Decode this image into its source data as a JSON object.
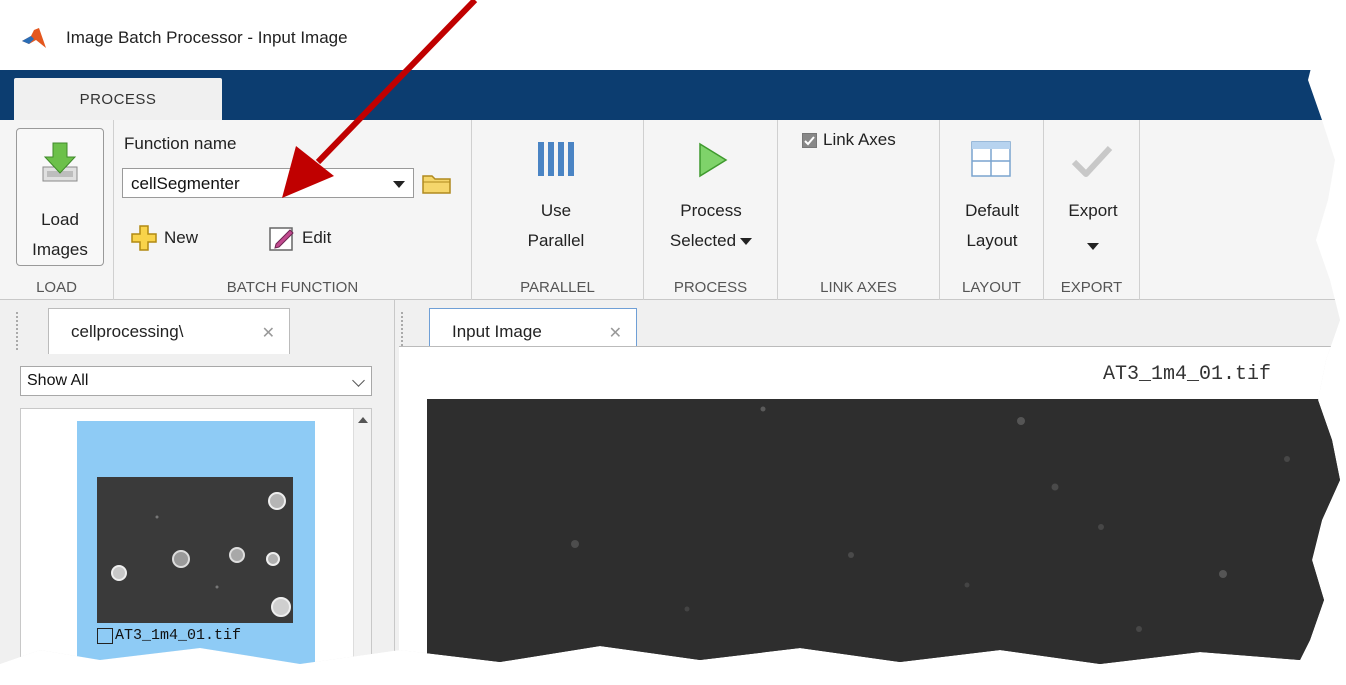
{
  "window": {
    "title": "Image Batch Processor - Input Image"
  },
  "toolstrip": {
    "active_tab": "PROCESS"
  },
  "ribbon": {
    "load": {
      "button_line1": "Load",
      "button_line2": "Images",
      "group_label": "LOAD"
    },
    "batch_function": {
      "function_name_label": "Function name",
      "function_name_value": "cellSegmenter",
      "new_label": "New",
      "edit_label": "Edit",
      "group_label": "BATCH FUNCTION"
    },
    "parallel": {
      "button_line1": "Use",
      "button_line2": "Parallel",
      "group_label": "PARALLEL"
    },
    "process": {
      "button_line1": "Process",
      "button_line2": "Selected",
      "group_label": "PROCESS"
    },
    "link_axes": {
      "checkbox_label": "Link Axes",
      "checked": true,
      "group_label": "LINK AXES"
    },
    "layout": {
      "button_line1": "Default",
      "button_line2": "Layout",
      "group_label": "LAYOUT"
    },
    "export": {
      "button_line1": "Export",
      "group_label": "EXPORT"
    }
  },
  "left_panel": {
    "tab_label": "cellprocessing\\",
    "filter_value": "Show All",
    "thumbnails": [
      {
        "label": "AT3_1m4_01.tif",
        "selected": true
      }
    ]
  },
  "right_panel": {
    "tab_label": "Input Image",
    "image_filename": "AT3_1m4_01.tif"
  },
  "colors": {
    "toolstrip_blue": "#0c3d70",
    "selection_blue": "#8ecbf5",
    "annotation_arrow": "#c00000",
    "matlab_logo": "#e4571e"
  }
}
